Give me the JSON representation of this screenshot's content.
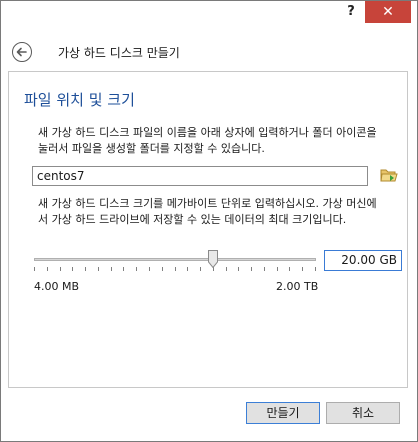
{
  "titlebar": {
    "help_label": "?",
    "close_label": "✕"
  },
  "header": {
    "back_icon": "back-arrow-icon",
    "title": "가상 하드 디스크 만들기"
  },
  "section": {
    "heading": "파일 위치 및 크기",
    "location_description": "새 가상 하드 디스크 파일의 이름을 아래 상자에 입력하거나 폴더 아이콘을 눌러서 파일을 생성할 폴더를 지정할 수 있습니다.",
    "location_value": "centos7",
    "folder_icon": "folder-open-icon",
    "size_description": "새 가상 하드 디스크 크기를 메가바이트 단위로 입력하십시오. 가상 머신에서 가상 하드 드라이브에 저장할 수 있는 데이터의 최대 크기입니다.",
    "size_value": "20.00 GB",
    "slider_min_label": "4.00 MB",
    "slider_max_label": "2.00 TB",
    "slider_level": 0.64
  },
  "buttons": {
    "create_label": "만들기",
    "cancel_label": "취소"
  },
  "colors": {
    "heading": "#1e4f99",
    "close": "#c7443a",
    "focus": "#3c7fd6"
  }
}
